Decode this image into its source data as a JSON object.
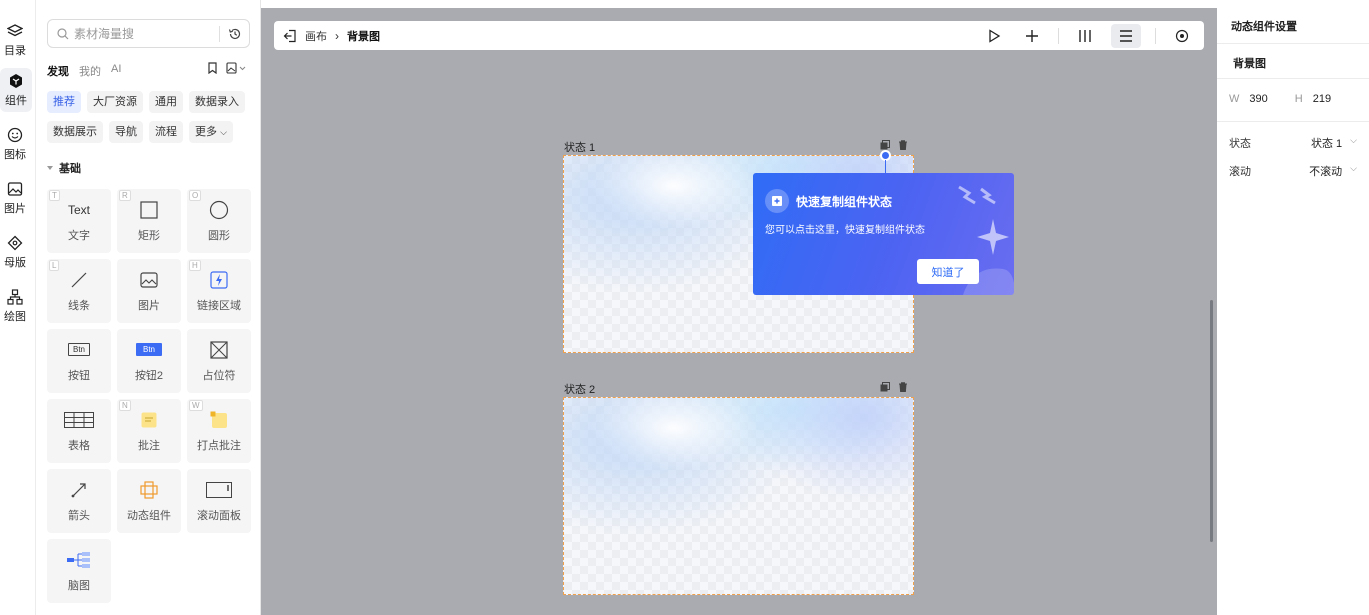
{
  "rail": [
    {
      "label": "目录",
      "icon": "layers-icon"
    },
    {
      "label": "组件",
      "icon": "component-icon",
      "active": true
    },
    {
      "label": "图标",
      "icon": "smiley-icon"
    },
    {
      "label": "图片",
      "icon": "image-icon"
    },
    {
      "label": "母版",
      "icon": "master-icon"
    },
    {
      "label": "绘图",
      "icon": "diagram-icon"
    }
  ],
  "library": {
    "search_placeholder": "素材海量搜",
    "tabs": [
      "发现",
      "我的",
      "AI"
    ],
    "chips": [
      "推荐",
      "大厂资源",
      "通用",
      "数据录入",
      "数据展示",
      "导航",
      "流程",
      "更多"
    ],
    "section": "基础",
    "tiles": [
      {
        "label": "文字",
        "key": "T",
        "glyph": "Text"
      },
      {
        "label": "矩形",
        "key": "R"
      },
      {
        "label": "圆形",
        "key": "O"
      },
      {
        "label": "线条",
        "key": "L"
      },
      {
        "label": "图片",
        "key": ""
      },
      {
        "label": "链接区域",
        "key": "H"
      },
      {
        "label": "按钮",
        "key": "",
        "glyph": "Btn"
      },
      {
        "label": "按钮2",
        "key": "",
        "glyph": "Btn"
      },
      {
        "label": "占位符",
        "key": ""
      },
      {
        "label": "表格",
        "key": ""
      },
      {
        "label": "批注",
        "key": "N"
      },
      {
        "label": "打点批注",
        "key": "W"
      },
      {
        "label": "箭头",
        "key": ""
      },
      {
        "label": "动态组件",
        "key": ""
      },
      {
        "label": "滚动面板",
        "key": ""
      },
      {
        "label": "脑图",
        "key": ""
      }
    ]
  },
  "toolbar": {
    "crumb_root": "画布",
    "crumb_current": "背景图"
  },
  "canvas": {
    "state1_label": "状态 1",
    "state2_label": "状态 2"
  },
  "tooltip": {
    "title": "快速复制组件状态",
    "desc": "您可以点击这里，快速复制组件状态",
    "ok": "知道了"
  },
  "panel": {
    "header": "动态组件设置",
    "name": "背景图",
    "w_label": "W",
    "w_value": "390",
    "h_label": "H",
    "h_value": "219",
    "state_label": "状态",
    "state_value": "状态 1",
    "scroll_label": "滚动",
    "scroll_value": "不滚动"
  },
  "colors": {
    "accent": "#3d6cf4",
    "canvas_bg": "#a9abb0",
    "frame_border": "#f0a04b"
  }
}
